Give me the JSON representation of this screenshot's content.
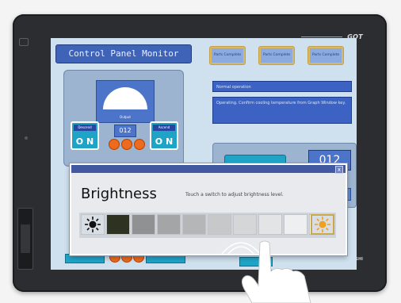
{
  "panel": {
    "title": "Control Panel Monitor",
    "top_buttons": [
      "Parts Complete",
      "Parts Complete",
      "Parts Complete"
    ],
    "messages": {
      "line1": "Normal operation",
      "line2": "Operating. Confirm cooling temperature from Graph Window key."
    },
    "gauge_label": "Output",
    "left_switch": {
      "label": "Descend",
      "value": "O N"
    },
    "right_switch": {
      "label": "Ascend",
      "value": "O N"
    },
    "counter": "012",
    "right_counter": "012",
    "lamp_color": "#ee6a1c"
  },
  "brand": {
    "logo": "GOT",
    "maker": "MITSUBISHI"
  },
  "dialog": {
    "title": "Brightness",
    "hint": "Touch a switch to adjust brightness level.",
    "close_label": "x",
    "levels": [
      "#2d3320",
      "#8f9193",
      "#a3a5a7",
      "#b4b6b8",
      "#c6c8ca",
      "#d4d6d8",
      "#e2e4e6",
      "#eeeff0",
      "#f8f8f8"
    ],
    "dim_icon": "dim-sun-icon",
    "bright_icon": "bright-sun-icon",
    "bright_icon_color": "#f0a020"
  }
}
